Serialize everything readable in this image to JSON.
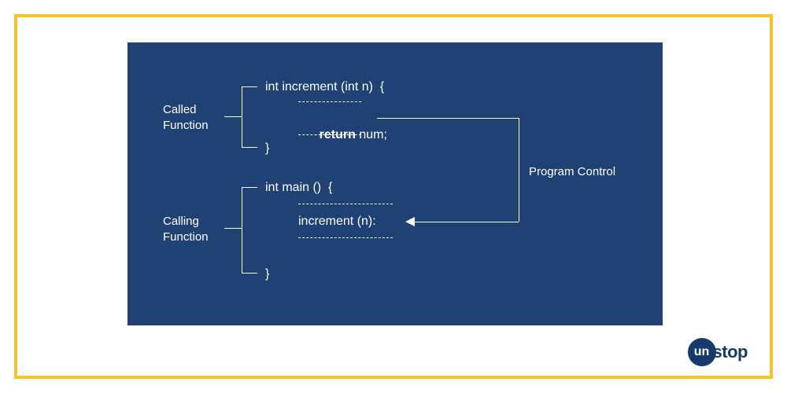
{
  "labels": {
    "called_function": "Called\nFunction",
    "calling_function": "Calling\nFunction",
    "program_control": "Program Control"
  },
  "code": {
    "increment_sig": "int increment (int n)  {",
    "return_stmt_kw": "return ",
    "return_stmt_rest": "num;",
    "close_brace_1": "}",
    "main_sig": "int main ()  {",
    "increment_call": "increment (n):",
    "close_brace_2": "}"
  },
  "logo": {
    "circle": "un",
    "rest": "stop"
  },
  "colors": {
    "panel_bg": "#1f4174",
    "border": "#f7c326",
    "logo": "#163a6b"
  }
}
